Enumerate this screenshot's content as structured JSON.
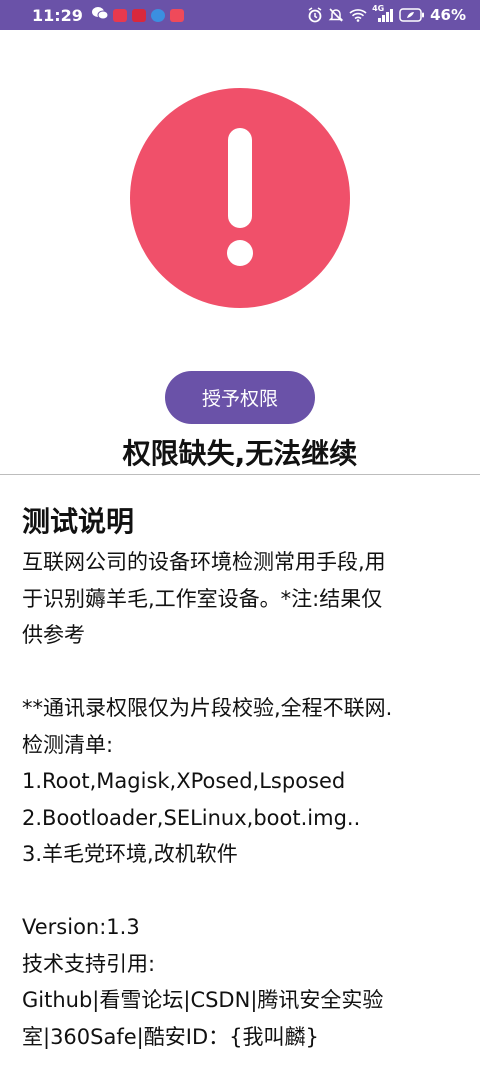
{
  "status_bar": {
    "time": "11:29",
    "battery_percent": "46%",
    "network_label": "4G",
    "colors": {
      "background": "#6a52a8",
      "text": "#ffffff"
    },
    "icons": [
      "wechat-icon",
      "app-icon-red",
      "app-icon-red-2",
      "app-icon-blue",
      "app-icon-red-3",
      "alarm-icon",
      "mute-icon",
      "wifi-icon",
      "signal-icon",
      "battery-icon"
    ]
  },
  "alert": {
    "icon": "exclamation-icon",
    "color": "#f0506a"
  },
  "grant_button": {
    "label": "授予权限",
    "color": "#6a52a8"
  },
  "error_title": "权限缺失,无法继续",
  "description": {
    "heading": "测试说明",
    "lines": [
      "互联网公司的设备环境检测常用手段,用",
      "于识别薅羊毛,工作室设备。*注:结果仅",
      "供参考",
      "",
      "**通讯录权限仅为片段校验,全程不联网.",
      "检测清单:",
      "1.Root,Magisk,XPosed,Lsposed",
      "2.Bootloader,SELinux,boot.img..",
      "3.羊毛党环境,改机软件",
      "",
      "Version:1.3",
      "技术支持引用:",
      "Github|看雪论坛|CSDN|腾讯安全实验",
      "室|360Safe|酷安ID：{我叫麟}"
    ]
  }
}
